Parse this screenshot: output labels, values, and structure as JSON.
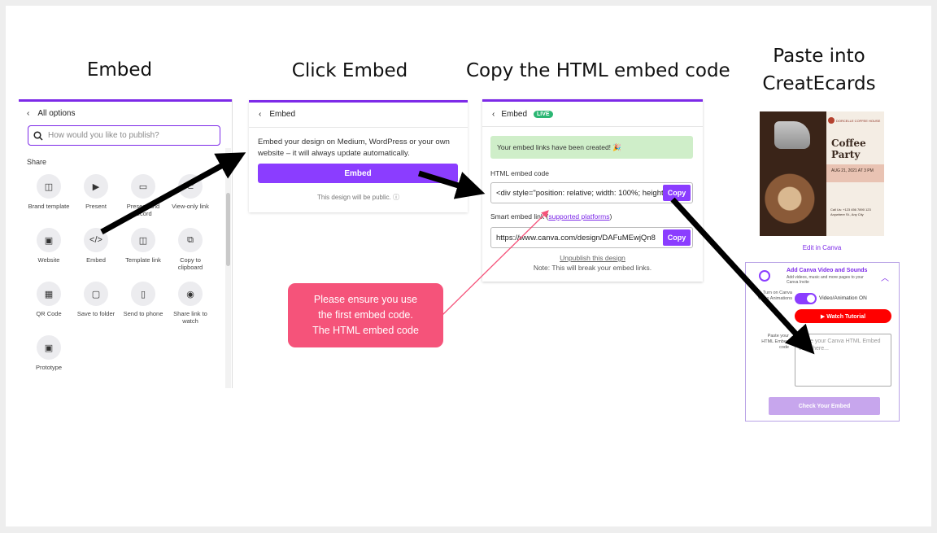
{
  "titles": {
    "t1": "Embed",
    "t2": "Click Embed",
    "t3": "Copy the HTML embed code",
    "t4a": "Paste into",
    "t4b": "CreatEcards"
  },
  "panel1": {
    "back_label": "All options",
    "search_placeholder": "How would you like to publish?",
    "share_heading": "Share",
    "items": [
      {
        "label": "Brand template",
        "icon": "brand-template-icon",
        "glyph": "◫"
      },
      {
        "label": "Present",
        "icon": "present-icon",
        "glyph": "▶"
      },
      {
        "label": "Present and record",
        "icon": "record-icon",
        "glyph": "▭"
      },
      {
        "label": "View-only link",
        "icon": "link-icon",
        "glyph": "⊂"
      },
      {
        "label": "Website",
        "icon": "website-icon",
        "glyph": "▣"
      },
      {
        "label": "Embed",
        "icon": "embed-icon",
        "glyph": "</>"
      },
      {
        "label": "Template link",
        "icon": "template-link-icon",
        "glyph": "◫"
      },
      {
        "label": "Copy to clipboard",
        "icon": "clipboard-icon",
        "glyph": "⧉"
      },
      {
        "label": "QR Code",
        "icon": "qr-code-icon",
        "glyph": "▦"
      },
      {
        "label": "Save to folder",
        "icon": "folder-icon",
        "glyph": "▢"
      },
      {
        "label": "Send to phone",
        "icon": "phone-icon",
        "glyph": "▯"
      },
      {
        "label": "Share link to watch",
        "icon": "eye-icon",
        "glyph": "◉"
      },
      {
        "label": "Prototype",
        "icon": "prototype-icon",
        "glyph": "▣"
      }
    ]
  },
  "panel2": {
    "title": "Embed",
    "description": "Embed your design on Medium, WordPress or your own website – it will always update automatically.",
    "button": "Embed",
    "public_note": "This design will be public. ⓘ"
  },
  "panel3": {
    "title": "Embed",
    "live": "LIVE",
    "alert": "Your embed links have been created! 🎉",
    "html_label": "HTML embed code",
    "html_value": "<div style=\"position: relative; width: 100%; height: 0;",
    "copy1": "Copy",
    "smart_label": "Smart embed link (",
    "smart_link": "supported platforms",
    "smart_label_end": ")",
    "smart_value": "https://www.canva.com/design/DAFuMEwjQn8",
    "copy2": "Copy",
    "unpublish": "Unpublish this design",
    "note": "Note: This will break your embed links."
  },
  "card": {
    "logo_text": "DORCELLE COFFEE HOUSE",
    "title": "Coffee Party",
    "date": "AUG 21, 2021 AT 3 PM",
    "info": "Call Us: +123 456 7890 123 Anywhere St., Any City",
    "edit_link": "Edit in Canva"
  },
  "createcards": {
    "title": "Add Canva Video and Sounds",
    "subtitle": "Add videos, music and more pages to your Canva Invite",
    "side1": "Turn on Canva Video Animations",
    "toggle_label": "Video/Animation ON",
    "watch": "▶ Watch Tutorial",
    "side2": "Paste your HTML Embed code",
    "textarea_placeholder": "Paste your Canva HTML Embed code here...",
    "check": "Check Your Embed"
  },
  "callout": {
    "line1": "Please ensure you use",
    "line2": "the first embed code.",
    "line3": "The HTML embed code"
  },
  "colors": {
    "accent": "#7d2ae8",
    "button": "#8b3dff",
    "callout": "#f5537a",
    "success": "#cfeec9",
    "live": "#2bb673",
    "watch": "#ff0000"
  }
}
